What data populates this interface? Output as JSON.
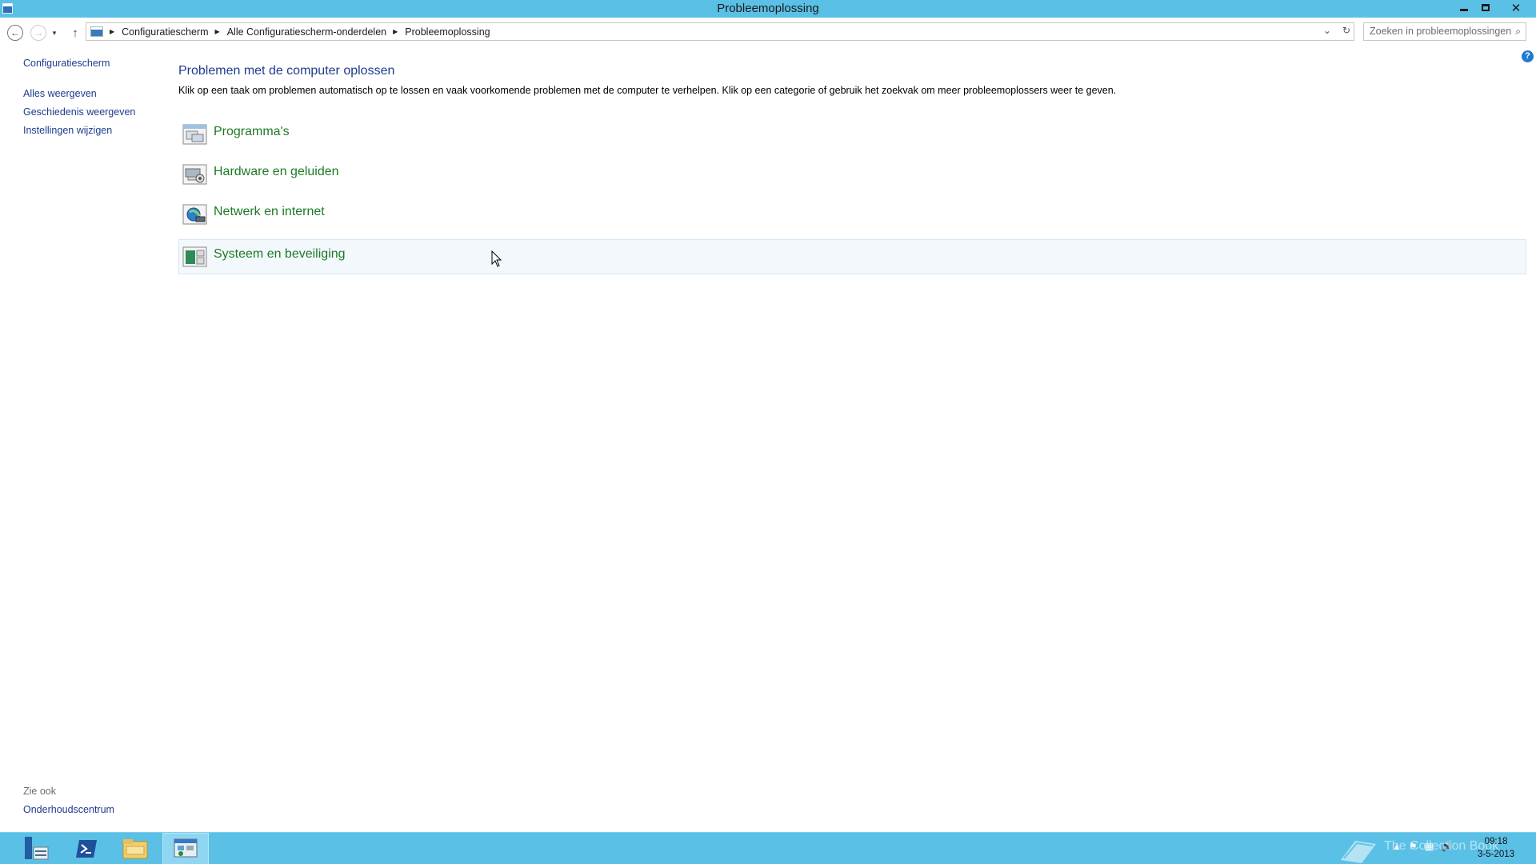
{
  "window": {
    "title": "Probleemoplossing",
    "minimize_icon": "minimize-icon",
    "maximize_icon": "restore-icon",
    "close_icon": "close-icon"
  },
  "address": {
    "crumbs": [
      "Configuratiescherm",
      "Alle Configuratiescherm-onderdelen",
      "Probleemoplossing"
    ]
  },
  "search": {
    "placeholder": "Zoeken in probleemoplossingen"
  },
  "sidebar": {
    "home": "Configuratiescherm",
    "links": [
      "Alles weergeven",
      "Geschiedenis weergeven",
      "Instellingen wijzigen"
    ],
    "see_also": "Zie ook",
    "bottom_link": "Onderhoudscentrum"
  },
  "main": {
    "title": "Problemen met de computer oplossen",
    "description": "Klik op een taak om problemen automatisch op te lossen en vaak voorkomende problemen met de computer te verhelpen. Klik op een categorie of gebruik het zoekvak om meer probleemoplossers weer te geven.",
    "categories": [
      {
        "label": "Programma's",
        "icon": "programs-icon"
      },
      {
        "label": "Hardware en geluiden",
        "icon": "hardware-sound-icon"
      },
      {
        "label": "Netwerk en internet",
        "icon": "network-internet-icon"
      },
      {
        "label": "Systeem en beveiliging",
        "icon": "system-security-icon"
      }
    ]
  },
  "taskbar": {
    "clock_time": "09:18",
    "clock_date": "3-5-2013",
    "watermark": "The Collection Book"
  },
  "colors": {
    "titlebar": "#5bc0e6",
    "link_blue": "#1e3c8c",
    "category_green": "#1c7a25"
  }
}
